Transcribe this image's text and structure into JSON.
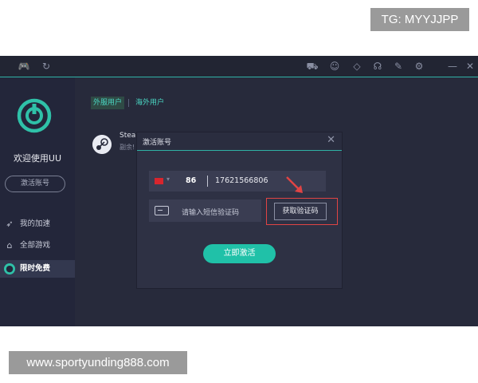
{
  "watermarks": {
    "tg": "TG: MYYJJPP",
    "url": "www.sportyunding888.com"
  },
  "sidebar": {
    "welcome": "欢迎使用UU",
    "activate_button": "激活账号",
    "nav": [
      {
        "label": "我的加速",
        "icon": "rocket-icon"
      },
      {
        "label": "全部游戏",
        "icon": "gamepad-icon"
      },
      {
        "label": "限时免费",
        "icon": "gift-icon",
        "active": true
      }
    ]
  },
  "tabs": [
    {
      "label": "外服用户",
      "active": true
    },
    {
      "label": "海外用户",
      "active": false
    }
  ],
  "game": {
    "name": "Stear",
    "subtitle": "副余!"
  },
  "dialog": {
    "title": "激活账号",
    "country_code": "86",
    "phone": "17621566806",
    "code_placeholder": "请输入短信验证码",
    "get_code_button": "获取验证码",
    "submit_button": "立即激活"
  },
  "colors": {
    "accent": "#20c1a8",
    "background": "#2a2d3d",
    "highlight": "#e04444"
  }
}
